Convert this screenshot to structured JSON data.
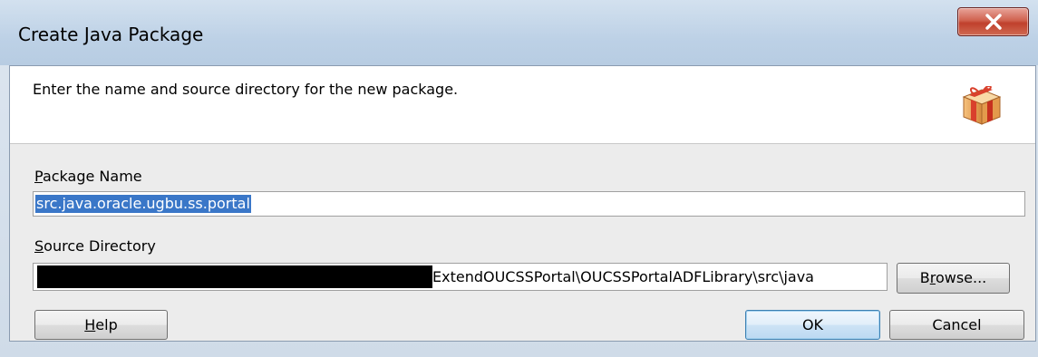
{
  "window": {
    "title": "Create Java Package"
  },
  "header": {
    "description": "Enter the name and source directory for the new package.",
    "icon": "package-icon"
  },
  "form": {
    "package_name": {
      "label_mnemonic": "P",
      "label_rest": "ackage Name",
      "value": "src.java.oracle.ugbu.ss.portal"
    },
    "source_directory": {
      "label_mnemonic": "S",
      "label_rest": "ource Directory",
      "value_visible": "ExtendOUCSSPortal\\OUCSSPortalADFLibrary\\src\\java"
    }
  },
  "buttons": {
    "browse": {
      "pre": "B",
      "mnemonic": "r",
      "post": "owse..."
    },
    "help": {
      "mnemonic": "H",
      "post": "elp"
    },
    "ok": "OK",
    "cancel": "Cancel"
  },
  "colors": {
    "selection": "#3a77c8",
    "close_button": "#c0402c",
    "titlebar": "#bdd1e6"
  }
}
